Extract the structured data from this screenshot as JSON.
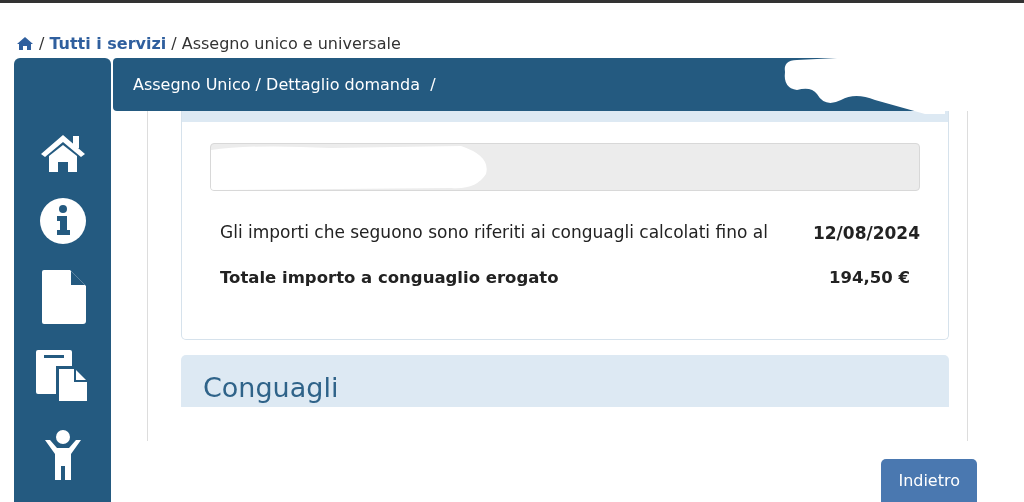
{
  "breadcrumb": [
    {
      "kind": "home"
    },
    {
      "kind": "separator",
      "text": "/"
    },
    {
      "kind": "link",
      "text": "Tutti i servizi"
    },
    {
      "kind": "separator",
      "text": "/"
    },
    {
      "kind": "current",
      "text": "Assegno unico e universale"
    }
  ],
  "header": {
    "title": "Assegno Unico / Dettaglio domanda  /"
  },
  "sidebar": {
    "items": [
      {
        "kind": "home"
      },
      {
        "kind": "info"
      },
      {
        "kind": "document"
      },
      {
        "kind": "documents"
      },
      {
        "kind": "child"
      }
    ]
  },
  "summary": {
    "rows": [
      {
        "label": "Gli importi che seguono sono riferiti ai conguagli calcolati fino al",
        "value": "12/08/2024",
        "bold": false
      },
      {
        "label": "Totale importo a conguaglio erogato",
        "value": "194,50 €",
        "bold": true
      }
    ]
  },
  "section": {
    "title": "Conguagli"
  },
  "back_button": {
    "label": "Indietro"
  }
}
